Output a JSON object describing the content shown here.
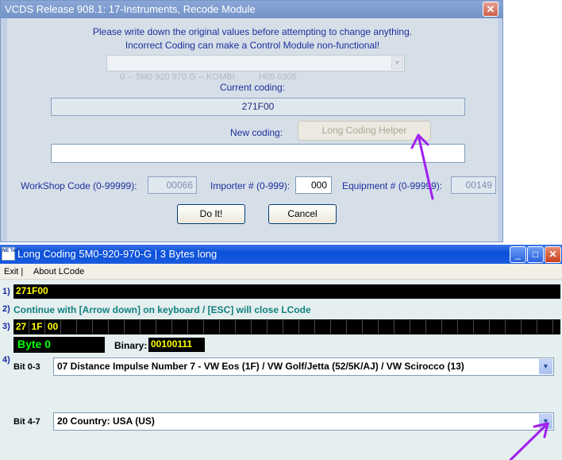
{
  "recode_window": {
    "title": "VCDS Release 908.1: 17-Instruments,  Recode Module",
    "close_label": "✕",
    "warning_line1": "Please write down the original values before attempting to change anything.",
    "warning_line2": "Incorrect Coding can make a Control Module non-functional!",
    "module_select": "0 -- 5M0 920 970 G -- KOMBI          H05 0305",
    "current_coding_label": "Current coding:",
    "current_coding_value": "271F00",
    "new_coding_label": "New coding:",
    "long_coding_helper_label": "Long Coding Helper",
    "new_coding_value": "",
    "workshop_label": "WorkShop Code (0-99999):",
    "workshop_value": "00066",
    "importer_label": "Importer # (0-999):",
    "importer_value": "000",
    "equipment_label": "Equipment # (0-99999):",
    "equipment_value": "00149",
    "doit_label": "Do It!",
    "cancel_label": "Cancel"
  },
  "lcode_window": {
    "icon_text": "NE Tech",
    "title": "Long Coding  5M0-920-970-G | 3 Bytes long",
    "minimize_label": "_",
    "maximize_label": "□",
    "close_label": "✕",
    "menu": {
      "exit": "Exit |",
      "about": "About LCode"
    },
    "row1_num": "1)",
    "coding_value": "271F00",
    "row2_num": "2)",
    "instruction": "Continue with [Arrow down] on keyboard / [ESC] will close LCode",
    "row3_num": "3)",
    "bytes": [
      "27",
      "1F",
      "00"
    ],
    "byte_label": "Byte 0",
    "binary_label": "Binary:",
    "binary_value": "00100111",
    "row4_num": "4)",
    "bit03_label": "Bit 0-3",
    "bit03_value": "07 Distance Impulse Number 7 - VW Eos (1F) / VW Golf/Jetta (52/5K/AJ) / VW Scirocco (13)",
    "bit47_label": "Bit 4-7",
    "bit47_value": "20 Country: USA (US)"
  },
  "colors": {
    "annotation_arrow": "#a020f0",
    "vcds_text_blue": "#1c2e9c",
    "lcode_yellow": "#ffff00",
    "lcode_green": "#00ff00",
    "lcode_teal": "#118080"
  }
}
